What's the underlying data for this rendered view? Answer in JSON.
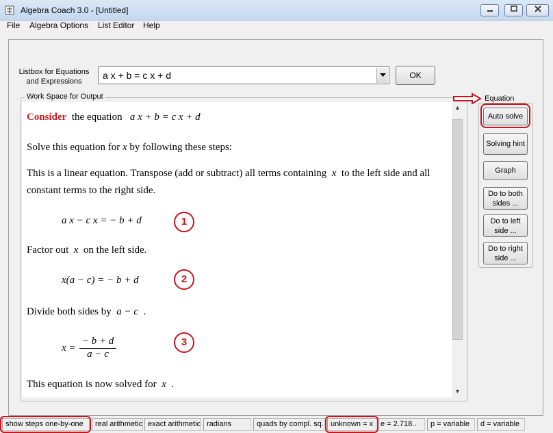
{
  "window": {
    "title": "Algebra Coach 3.0 - [Untitled]",
    "app_icon": "app-icon",
    "controls": {
      "minimize": "—",
      "maximize": "□",
      "close": "✕"
    }
  },
  "menu": [
    "File",
    "Algebra Options",
    "List Editor",
    "Help"
  ],
  "listbox": {
    "label_line1": "Listbox for Equations",
    "label_line2": "and Expressions",
    "value": "a x + b = c x + d",
    "dropdown_icon": "chevron-down-icon",
    "ok_label": "OK"
  },
  "workspace": {
    "legend": "Work Space for Output",
    "consider": "Consider",
    "consider_rest": "the equation",
    "consider_eq": "a x + b = c x + d",
    "solve_line_pre": "Solve this equation for",
    "solve_var": "x",
    "solve_line_post": "by following these steps:",
    "linear_pre": "This is a linear equation.  Transpose (add or subtract) all terms containing",
    "linear_var": "x",
    "linear_post": "to the left side and all",
    "linear_line2": "constant terms to the right side.",
    "step1_eq": "a x − c x =  − b + d",
    "step1_num": "1",
    "factor_pre": "Factor out",
    "factor_var": "x",
    "factor_post": "on the left side.",
    "step2_eq_x": "x",
    "step2_eq_paren": "(a − c)",
    "step2_eq_rhs": "=  − b + d",
    "step2_num": "2",
    "divide_pre": "Divide both sides by",
    "divide_expr": "a − c",
    "divide_post": ".",
    "step3_lhs": "x =",
    "step3_numer": "− b + d",
    "step3_denom": "a − c",
    "step3_num": "3",
    "solved_pre": "This equation is now solved for",
    "solved_var": "x",
    "solved_post": "."
  },
  "equation_panel": {
    "legend": "Equation",
    "buttons": [
      "Auto solve",
      "Solving hint",
      "Graph",
      "Do to both sides ...",
      "Do to left side ...",
      "Do to right side ..."
    ]
  },
  "statusbar": [
    "show steps one-by-one",
    "real arithmetic",
    "exact arithmetic",
    "radians",
    "quads by compl. sq.",
    "unknown = x",
    "e = 2.718..",
    "p = variable",
    "d = variable"
  ],
  "scrollbar": {
    "up_icon": "▲",
    "down_icon": "▼"
  },
  "colors": {
    "highlight": "#c8141e",
    "consider": "#d01818"
  }
}
